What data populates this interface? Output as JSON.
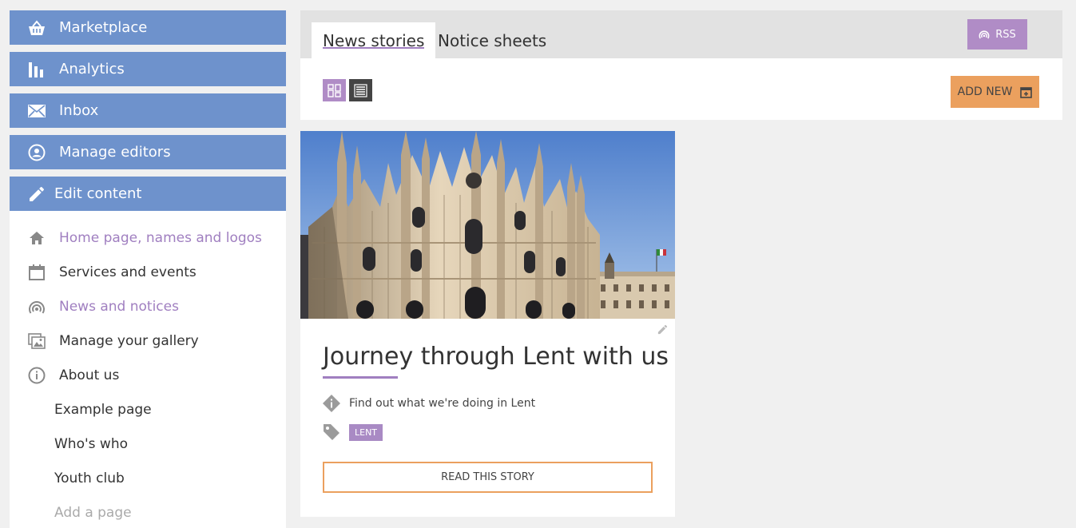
{
  "sidebar": {
    "main_items": [
      {
        "label": "Marketplace",
        "icon": "basket-icon"
      },
      {
        "label": "Analytics",
        "icon": "bar-chart-icon"
      },
      {
        "label": "Inbox",
        "icon": "envelope-icon"
      },
      {
        "label": "Manage editors",
        "icon": "user-circle-icon"
      },
      {
        "label": "Edit content",
        "icon": "pencil-icon"
      }
    ],
    "sub_items": [
      {
        "label": "Home page, names and logos",
        "icon": "home-icon"
      },
      {
        "label": "Services and events",
        "icon": "calendar-icon"
      },
      {
        "label": "News and notices",
        "icon": "broadcast-icon"
      },
      {
        "label": "Manage your gallery",
        "icon": "gallery-icon"
      },
      {
        "label": "About us",
        "icon": "info-circle-icon"
      }
    ],
    "child_items": [
      "Example page",
      "Who's who",
      "Youth club"
    ],
    "add_page_label": "Add a page"
  },
  "tabs": [
    {
      "label": "News stories",
      "active": true
    },
    {
      "label": "Notice sheets",
      "active": false
    }
  ],
  "rss_label": "RSS",
  "add_new_label": "ADD NEW",
  "story": {
    "title": "Journey through Lent with us",
    "summary": "Find out what we're doing in Lent",
    "tag": "LENT",
    "read_label": "READ THIS STORY"
  },
  "colors": {
    "nav_blue": "#6e92cc",
    "accent_purple": "#a07fc0",
    "accent_orange": "#eba05e"
  }
}
